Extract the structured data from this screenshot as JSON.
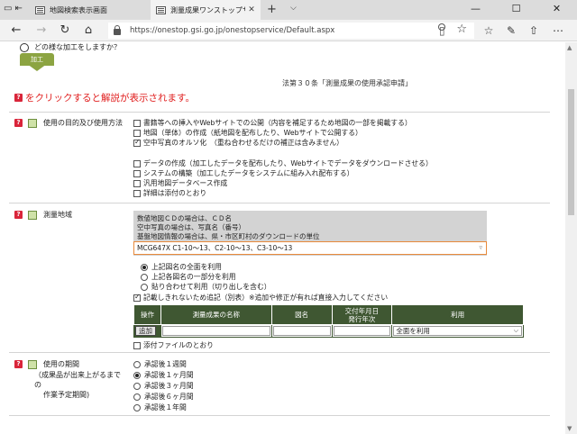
{
  "browser": {
    "tabs": [
      {
        "title": "地図検索表示画面",
        "active": false
      },
      {
        "title": "測量成果ワンストップサービ",
        "active": true
      }
    ],
    "url": "https://onestop.gsi.go.jp/onestopservice/Default.aspx"
  },
  "page": {
    "question": "どの様な加工をしますか？",
    "tag_label": "加工",
    "law_title": "法第３０条「測量成果の使用承認申請」",
    "hint": "をクリックすると解説が表示されます。",
    "sections": {
      "purpose": {
        "label": "使用の目的及び使用方法",
        "options": [
          {
            "text": "書籍等への挿入やWebサイトでの公開（内容を補足するため地図の一部を掲載する）",
            "checked": false
          },
          {
            "text": "地図（単体）の作成（紙地図を配布したり、Webサイトで公開する）",
            "checked": false
          },
          {
            "text": "空中写真のオルソ化　（重ね合わせるだけの補正は含みません）",
            "checked": true
          },
          {
            "text": "データの作成（加工したデータを配布したり、Webサイトでデータをダウンロードさせる）",
            "checked": false
          },
          {
            "text": "システムの構築（加工したデータをシステムに組み入れ配布する）",
            "checked": false
          },
          {
            "text": "汎用地図データベース作成",
            "checked": false
          },
          {
            "text": "詳細は添付のとおり",
            "checked": false
          }
        ]
      },
      "area": {
        "label": "測量地域",
        "info": [
          "数値地図ＣＤの場合は、ＣＤ名",
          "空中写真の場合は、写真名（番号）",
          "基盤地図情報の場合は、県・市区町村のダウンロードの単位"
        ],
        "value": "MCG647X C1-10～13、C2-10～13、C3-10～13",
        "radios": [
          {
            "text": "上記図名の全面を利用",
            "checked": true
          },
          {
            "text": "上記各図名の一部分を利用",
            "checked": false
          },
          {
            "text": "貼り合わせて利用（切り出しを含む）",
            "checked": false
          }
        ],
        "extra_checkbox": "記載しきれないため追記（別表）※追加や修正が有れば直接入力してください",
        "table": {
          "headers": [
            "操作",
            "測量成果の名称",
            "図名",
            "交付年月日\n発行年次",
            "利用"
          ],
          "add_button": "追加",
          "usage_value": "全面を利用"
        },
        "attachment": "添付ファイルのとおり"
      },
      "period": {
        "label": "使用の期間",
        "sublabel1": "（成果品が出来上がるまでの",
        "sublabel2": "作業予定期間)",
        "options": [
          {
            "text": "承認後１週間",
            "checked": false
          },
          {
            "text": "承認後１ヶ月間",
            "checked": true
          },
          {
            "text": "承認後３ヶ月間",
            "checked": false
          },
          {
            "text": "承認後６ヶ月間",
            "checked": false
          },
          {
            "text": "承認後１年間",
            "checked": false
          }
        ]
      }
    }
  }
}
